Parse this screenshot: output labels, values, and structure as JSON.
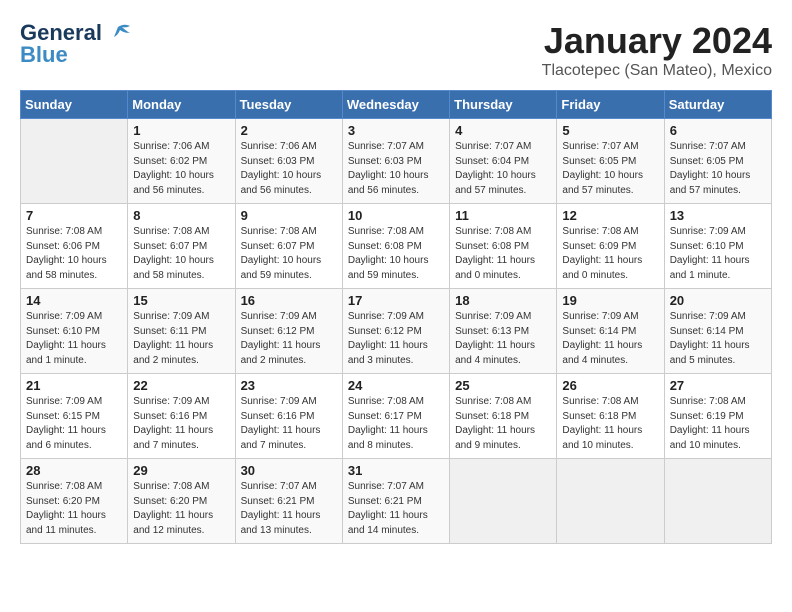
{
  "logo": {
    "line1": "General",
    "line2": "Blue"
  },
  "title": "January 2024",
  "location": "Tlacotepec (San Mateo), Mexico",
  "days_header": [
    "Sunday",
    "Monday",
    "Tuesday",
    "Wednesday",
    "Thursday",
    "Friday",
    "Saturday"
  ],
  "weeks": [
    [
      {
        "day": "",
        "info": ""
      },
      {
        "day": "1",
        "info": "Sunrise: 7:06 AM\nSunset: 6:02 PM\nDaylight: 10 hours\nand 56 minutes."
      },
      {
        "day": "2",
        "info": "Sunrise: 7:06 AM\nSunset: 6:03 PM\nDaylight: 10 hours\nand 56 minutes."
      },
      {
        "day": "3",
        "info": "Sunrise: 7:07 AM\nSunset: 6:03 PM\nDaylight: 10 hours\nand 56 minutes."
      },
      {
        "day": "4",
        "info": "Sunrise: 7:07 AM\nSunset: 6:04 PM\nDaylight: 10 hours\nand 57 minutes."
      },
      {
        "day": "5",
        "info": "Sunrise: 7:07 AM\nSunset: 6:05 PM\nDaylight: 10 hours\nand 57 minutes."
      },
      {
        "day": "6",
        "info": "Sunrise: 7:07 AM\nSunset: 6:05 PM\nDaylight: 10 hours\nand 57 minutes."
      }
    ],
    [
      {
        "day": "7",
        "info": "Sunrise: 7:08 AM\nSunset: 6:06 PM\nDaylight: 10 hours\nand 58 minutes."
      },
      {
        "day": "8",
        "info": "Sunrise: 7:08 AM\nSunset: 6:07 PM\nDaylight: 10 hours\nand 58 minutes."
      },
      {
        "day": "9",
        "info": "Sunrise: 7:08 AM\nSunset: 6:07 PM\nDaylight: 10 hours\nand 59 minutes."
      },
      {
        "day": "10",
        "info": "Sunrise: 7:08 AM\nSunset: 6:08 PM\nDaylight: 10 hours\nand 59 minutes."
      },
      {
        "day": "11",
        "info": "Sunrise: 7:08 AM\nSunset: 6:08 PM\nDaylight: 11 hours\nand 0 minutes."
      },
      {
        "day": "12",
        "info": "Sunrise: 7:08 AM\nSunset: 6:09 PM\nDaylight: 11 hours\nand 0 minutes."
      },
      {
        "day": "13",
        "info": "Sunrise: 7:09 AM\nSunset: 6:10 PM\nDaylight: 11 hours\nand 1 minute."
      }
    ],
    [
      {
        "day": "14",
        "info": "Sunrise: 7:09 AM\nSunset: 6:10 PM\nDaylight: 11 hours\nand 1 minute."
      },
      {
        "day": "15",
        "info": "Sunrise: 7:09 AM\nSunset: 6:11 PM\nDaylight: 11 hours\nand 2 minutes."
      },
      {
        "day": "16",
        "info": "Sunrise: 7:09 AM\nSunset: 6:12 PM\nDaylight: 11 hours\nand 2 minutes."
      },
      {
        "day": "17",
        "info": "Sunrise: 7:09 AM\nSunset: 6:12 PM\nDaylight: 11 hours\nand 3 minutes."
      },
      {
        "day": "18",
        "info": "Sunrise: 7:09 AM\nSunset: 6:13 PM\nDaylight: 11 hours\nand 4 minutes."
      },
      {
        "day": "19",
        "info": "Sunrise: 7:09 AM\nSunset: 6:14 PM\nDaylight: 11 hours\nand 4 minutes."
      },
      {
        "day": "20",
        "info": "Sunrise: 7:09 AM\nSunset: 6:14 PM\nDaylight: 11 hours\nand 5 minutes."
      }
    ],
    [
      {
        "day": "21",
        "info": "Sunrise: 7:09 AM\nSunset: 6:15 PM\nDaylight: 11 hours\nand 6 minutes."
      },
      {
        "day": "22",
        "info": "Sunrise: 7:09 AM\nSunset: 6:16 PM\nDaylight: 11 hours\nand 7 minutes."
      },
      {
        "day": "23",
        "info": "Sunrise: 7:09 AM\nSunset: 6:16 PM\nDaylight: 11 hours\nand 7 minutes."
      },
      {
        "day": "24",
        "info": "Sunrise: 7:08 AM\nSunset: 6:17 PM\nDaylight: 11 hours\nand 8 minutes."
      },
      {
        "day": "25",
        "info": "Sunrise: 7:08 AM\nSunset: 6:18 PM\nDaylight: 11 hours\nand 9 minutes."
      },
      {
        "day": "26",
        "info": "Sunrise: 7:08 AM\nSunset: 6:18 PM\nDaylight: 11 hours\nand 10 minutes."
      },
      {
        "day": "27",
        "info": "Sunrise: 7:08 AM\nSunset: 6:19 PM\nDaylight: 11 hours\nand 10 minutes."
      }
    ],
    [
      {
        "day": "28",
        "info": "Sunrise: 7:08 AM\nSunset: 6:20 PM\nDaylight: 11 hours\nand 11 minutes."
      },
      {
        "day": "29",
        "info": "Sunrise: 7:08 AM\nSunset: 6:20 PM\nDaylight: 11 hours\nand 12 minutes."
      },
      {
        "day": "30",
        "info": "Sunrise: 7:07 AM\nSunset: 6:21 PM\nDaylight: 11 hours\nand 13 minutes."
      },
      {
        "day": "31",
        "info": "Sunrise: 7:07 AM\nSunset: 6:21 PM\nDaylight: 11 hours\nand 14 minutes."
      },
      {
        "day": "",
        "info": ""
      },
      {
        "day": "",
        "info": ""
      },
      {
        "day": "",
        "info": ""
      }
    ]
  ]
}
